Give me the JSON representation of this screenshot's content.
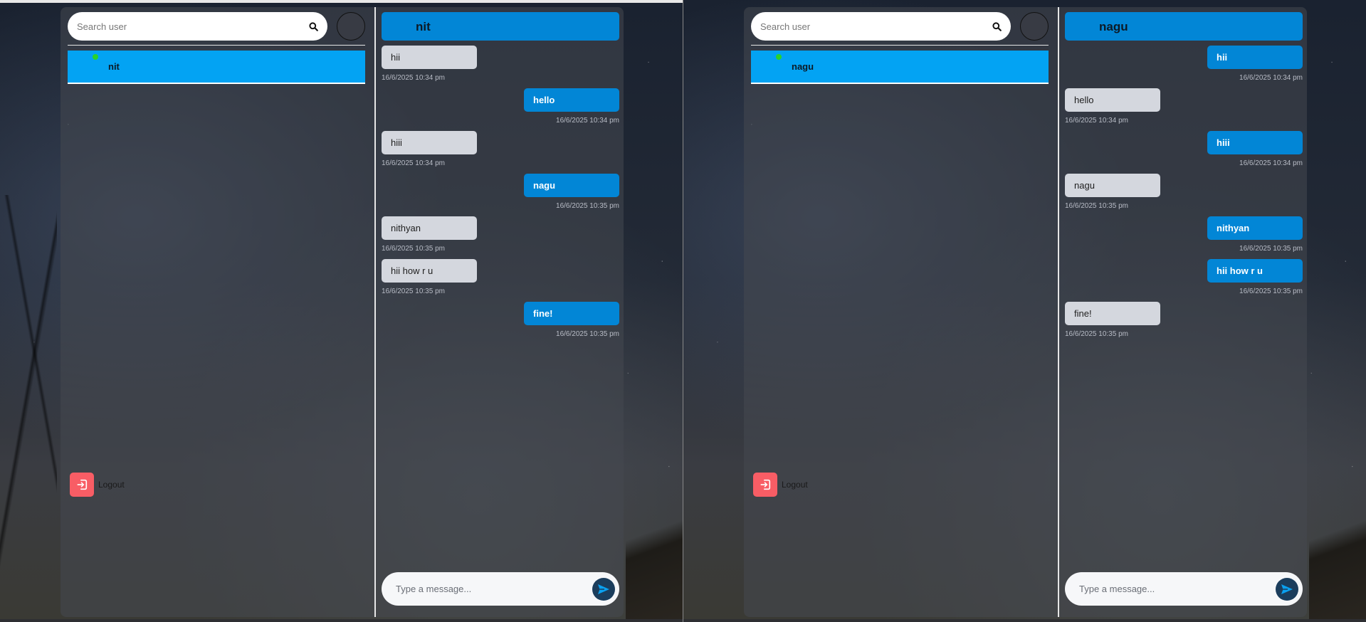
{
  "panes": [
    {
      "search": {
        "placeholder": "Search user",
        "icon": "search-icon"
      },
      "users": [
        {
          "name": "nit",
          "online": true
        }
      ],
      "logout": {
        "label": "Logout",
        "icon": "logout-icon"
      },
      "chat": {
        "title": "nit",
        "messages": [
          {
            "text": "hii",
            "time": "16/6/2025 10:34 pm",
            "dir": "in"
          },
          {
            "text": "hello",
            "time": "16/6/2025 10:34 pm",
            "dir": "out"
          },
          {
            "text": "hiii",
            "time": "16/6/2025 10:34 pm",
            "dir": "in"
          },
          {
            "text": "nagu",
            "time": "16/6/2025 10:35 pm",
            "dir": "out"
          },
          {
            "text": "nithyan",
            "time": "16/6/2025 10:35 pm",
            "dir": "in"
          },
          {
            "text": "hii how r u",
            "time": "16/6/2025 10:35 pm",
            "dir": "in"
          },
          {
            "text": "fine!",
            "time": "16/6/2025 10:35 pm",
            "dir": "out"
          }
        ],
        "composer": {
          "placeholder": "Type a message...",
          "send_icon": "send-icon"
        }
      }
    },
    {
      "search": {
        "placeholder": "Search user",
        "icon": "search-icon"
      },
      "users": [
        {
          "name": "nagu",
          "online": true
        }
      ],
      "logout": {
        "label": "Logout",
        "icon": "logout-icon"
      },
      "chat": {
        "title": "nagu",
        "messages": [
          {
            "text": "hii",
            "time": "16/6/2025 10:34 pm",
            "dir": "out"
          },
          {
            "text": "hello",
            "time": "16/6/2025 10:34 pm",
            "dir": "in"
          },
          {
            "text": "hiii",
            "time": "16/6/2025 10:34 pm",
            "dir": "out"
          },
          {
            "text": "nagu",
            "time": "16/6/2025 10:35 pm",
            "dir": "in"
          },
          {
            "text": "nithyan",
            "time": "16/6/2025 10:35 pm",
            "dir": "out"
          },
          {
            "text": "hii how r u",
            "time": "16/6/2025 10:35 pm",
            "dir": "out"
          },
          {
            "text": "fine!",
            "time": "16/6/2025 10:35 pm",
            "dir": "in"
          }
        ],
        "composer": {
          "placeholder": "Type a message...",
          "send_icon": "send-icon"
        }
      }
    }
  ],
  "colors": {
    "accent": "#03a3f3",
    "header": "#0286d6",
    "incoming_bubble": "#d4d7de",
    "logout": "#f85d65",
    "online": "#2ad22a",
    "send_button": "#1b3d5c"
  }
}
